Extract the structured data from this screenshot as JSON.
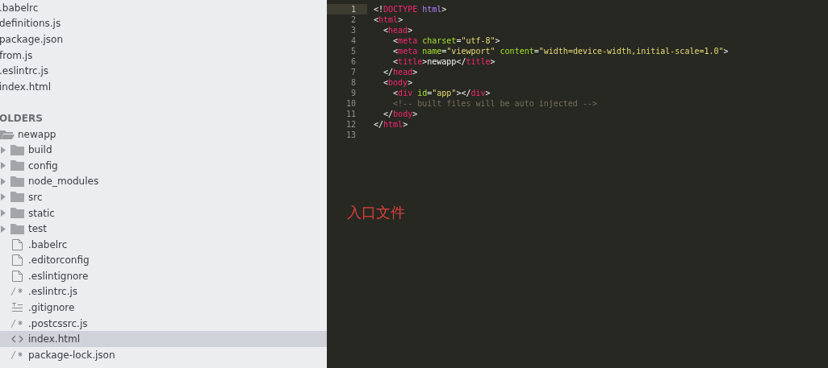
{
  "open_files": [
    {
      "label": ".babelrc",
      "selected": false
    },
    {
      "label": "definitions.js",
      "selected": false
    },
    {
      "label": "package.json",
      "selected": false
    },
    {
      "label": "from.js",
      "selected": false
    },
    {
      "label": ".eslintrc.js",
      "selected": false
    },
    {
      "label": "index.html",
      "selected": false
    }
  ],
  "folders_header": "OLDERS",
  "folders": [
    {
      "label": "newapp",
      "kind": "folder",
      "expanded": true,
      "selected": false,
      "children": [
        {
          "label": "build",
          "kind": "folder",
          "expanded": false,
          "selected": false
        },
        {
          "label": "config",
          "kind": "folder",
          "expanded": false,
          "selected": false
        },
        {
          "label": "node_modules",
          "kind": "folder",
          "expanded": false,
          "selected": false
        },
        {
          "label": "src",
          "kind": "folder",
          "expanded": false,
          "selected": false
        },
        {
          "label": "static",
          "kind": "folder",
          "expanded": false,
          "selected": false
        },
        {
          "label": "test",
          "kind": "folder",
          "expanded": false,
          "selected": false
        },
        {
          "label": ".babelrc",
          "kind": "file",
          "selected": false
        },
        {
          "label": ".editorconfig",
          "kind": "file",
          "selected": false
        },
        {
          "label": ".eslintignore",
          "kind": "file",
          "selected": false
        },
        {
          "label": ".eslintrc.js",
          "kind": "script",
          "selected": false
        },
        {
          "label": ".gitignore",
          "kind": "text",
          "selected": false
        },
        {
          "label": ".postcssrc.js",
          "kind": "script",
          "selected": false
        },
        {
          "label": "index.html",
          "kind": "markup",
          "selected": true
        },
        {
          "label": "package-lock.json",
          "kind": "script",
          "selected": false
        }
      ]
    }
  ],
  "editor": {
    "lines": [
      {
        "number": "1",
        "current": true,
        "tokens": [
          {
            "kind": "punct",
            "text": "<!"
          },
          {
            "kind": "tag",
            "text": "DOCTYPE"
          },
          {
            "kind": "keyword",
            "text": " html"
          },
          {
            "kind": "punct",
            "text": ">"
          }
        ]
      },
      {
        "number": "2",
        "current": false,
        "tokens": [
          {
            "kind": "punct",
            "text": "<"
          },
          {
            "kind": "tag",
            "text": "html"
          },
          {
            "kind": "punct",
            "text": ">"
          }
        ]
      },
      {
        "number": "3",
        "current": false,
        "tokens": [
          {
            "kind": "punct",
            "text": "  <"
          },
          {
            "kind": "tag",
            "text": "head"
          },
          {
            "kind": "punct",
            "text": ">"
          }
        ]
      },
      {
        "number": "4",
        "current": false,
        "tokens": [
          {
            "kind": "punct",
            "text": "    <"
          },
          {
            "kind": "tag",
            "text": "meta"
          },
          {
            "kind": "attr",
            "text": " charset"
          },
          {
            "kind": "punct",
            "text": "="
          },
          {
            "kind": "string",
            "text": "\"utf-8\""
          },
          {
            "kind": "punct",
            "text": ">"
          }
        ]
      },
      {
        "number": "5",
        "current": false,
        "tokens": [
          {
            "kind": "punct",
            "text": "    <"
          },
          {
            "kind": "tag",
            "text": "meta"
          },
          {
            "kind": "attr",
            "text": " name"
          },
          {
            "kind": "punct",
            "text": "="
          },
          {
            "kind": "string",
            "text": "\"viewport\""
          },
          {
            "kind": "attr",
            "text": " content"
          },
          {
            "kind": "punct",
            "text": "="
          },
          {
            "kind": "string",
            "text": "\"width=device-width,initial-scale=1.0\""
          },
          {
            "kind": "punct",
            "text": ">"
          }
        ]
      },
      {
        "number": "6",
        "current": false,
        "tokens": [
          {
            "kind": "punct",
            "text": "    <"
          },
          {
            "kind": "tag",
            "text": "title"
          },
          {
            "kind": "punct",
            "text": ">newapp</"
          },
          {
            "kind": "tag",
            "text": "title"
          },
          {
            "kind": "punct",
            "text": ">"
          }
        ]
      },
      {
        "number": "7",
        "current": false,
        "tokens": [
          {
            "kind": "punct",
            "text": "  </"
          },
          {
            "kind": "tag",
            "text": "head"
          },
          {
            "kind": "punct",
            "text": ">"
          }
        ]
      },
      {
        "number": "8",
        "current": false,
        "tokens": [
          {
            "kind": "punct",
            "text": "  <"
          },
          {
            "kind": "tag",
            "text": "body"
          },
          {
            "kind": "punct",
            "text": ">"
          }
        ]
      },
      {
        "number": "9",
        "current": false,
        "tokens": [
          {
            "kind": "punct",
            "text": "    <"
          },
          {
            "kind": "tag",
            "text": "div"
          },
          {
            "kind": "attr",
            "text": " id"
          },
          {
            "kind": "punct",
            "text": "="
          },
          {
            "kind": "string",
            "text": "\"app\""
          },
          {
            "kind": "punct",
            "text": "></"
          },
          {
            "kind": "tag",
            "text": "div"
          },
          {
            "kind": "punct",
            "text": ">"
          }
        ]
      },
      {
        "number": "10",
        "current": false,
        "tokens": [
          {
            "kind": "comment",
            "text": "    <!-- built files will be auto injected -->"
          }
        ]
      },
      {
        "number": "11",
        "current": false,
        "tokens": [
          {
            "kind": "punct",
            "text": "  </"
          },
          {
            "kind": "tag",
            "text": "body"
          },
          {
            "kind": "punct",
            "text": ">"
          }
        ]
      },
      {
        "number": "12",
        "current": false,
        "tokens": [
          {
            "kind": "punct",
            "text": "</"
          },
          {
            "kind": "tag",
            "text": "html"
          },
          {
            "kind": "punct",
            "text": ">"
          }
        ]
      },
      {
        "number": "13",
        "current": false
      }
    ],
    "annotation": "入口文件"
  }
}
